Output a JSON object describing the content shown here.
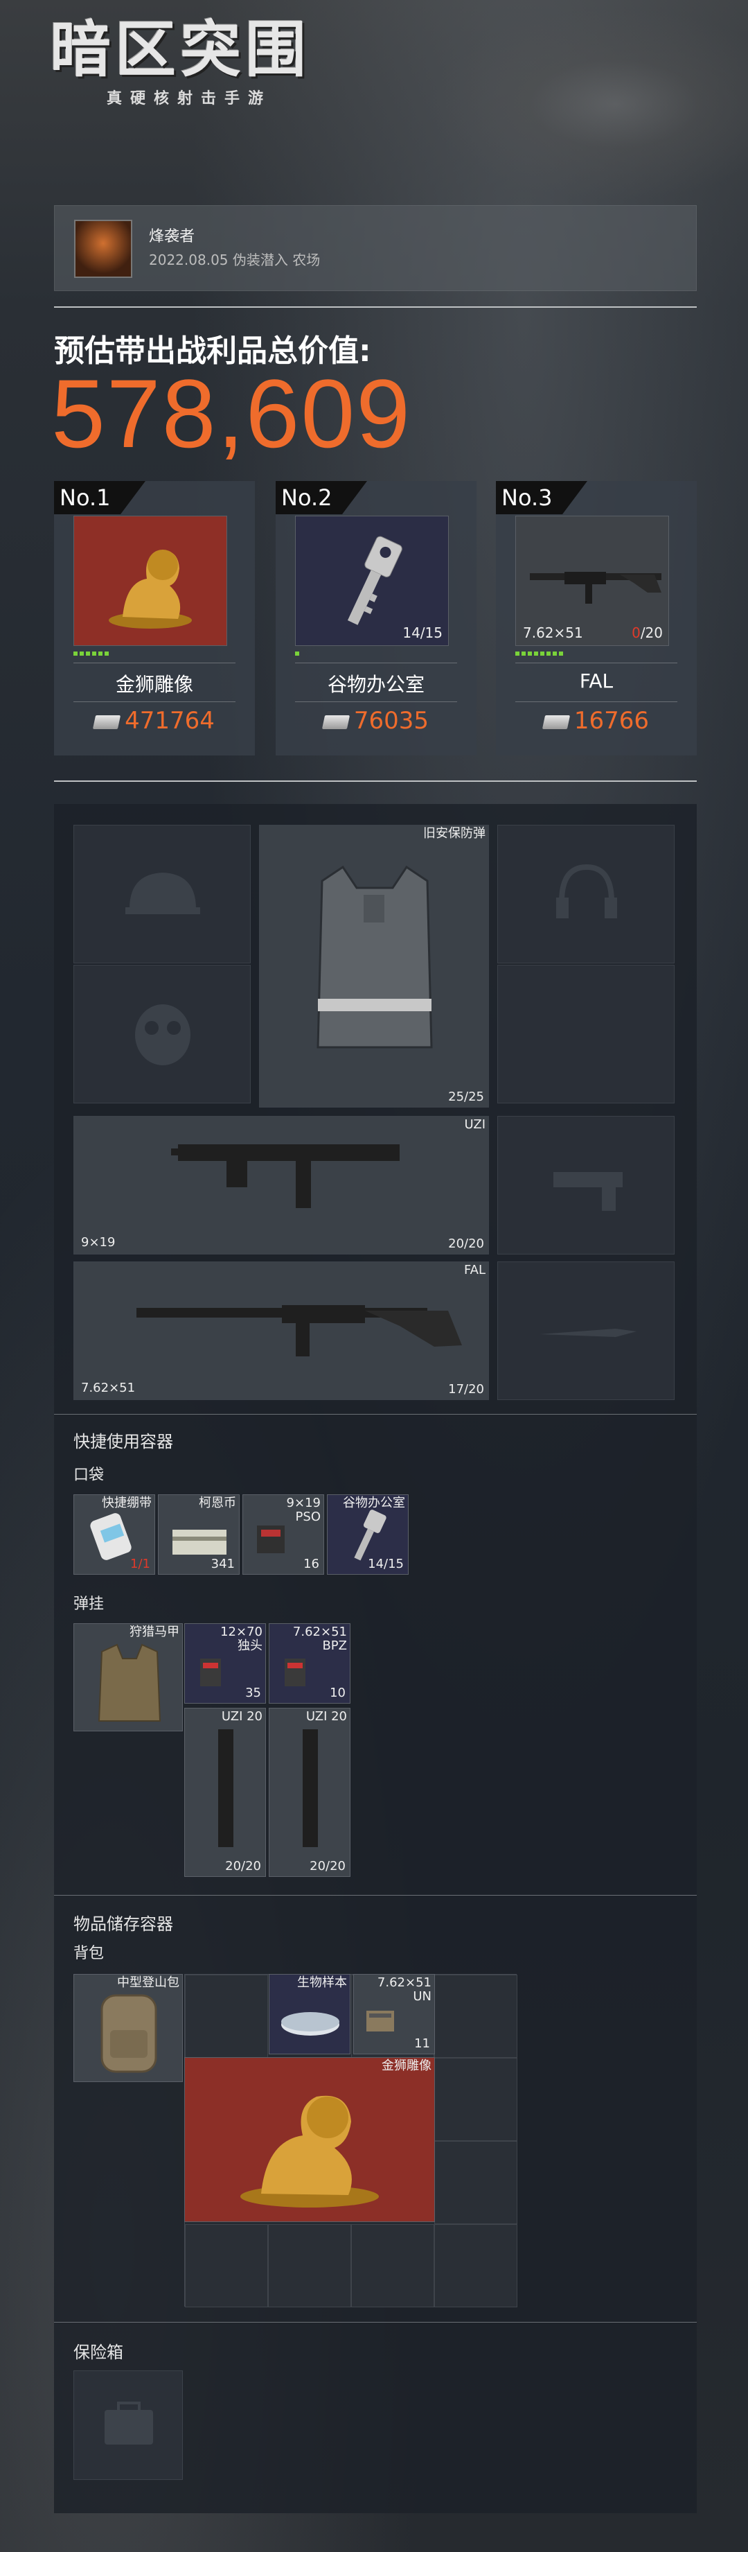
{
  "logo": {
    "title": "暗区突围",
    "subtitle": "真硬核射击手游"
  },
  "user": {
    "name": "烽袭者",
    "info": "2022.08.05 伪装潜入 农场"
  },
  "summary": {
    "label": "预估带出战利品总价值:",
    "value": "578,609"
  },
  "top_items": [
    {
      "rank": "No.1",
      "name": "金狮雕像",
      "price": "471764",
      "count": "",
      "caliber": "",
      "bg": "#8e2f26",
      "rarity": 6
    },
    {
      "rank": "No.2",
      "name": "谷物办公室",
      "price": "76035",
      "count": "14/15",
      "caliber": "",
      "bg": "#2b2d45",
      "rarity": 1
    },
    {
      "rank": "No.3",
      "name": "FAL",
      "price": "16766",
      "count_red": "0",
      "count": "/20",
      "caliber": "7.62×51",
      "bg": "#3f4348",
      "rarity": 8
    }
  ],
  "equipment": {
    "armor": {
      "label": "旧安保防弹",
      "count": "25/25"
    },
    "primary": {
      "label": "UZI",
      "caliber": "9×19",
      "count": "20/20"
    },
    "secondary": {
      "label": "FAL",
      "caliber": "7.62×51",
      "count": "17/20"
    }
  },
  "quick": {
    "title": "快捷使用容器",
    "pocket_title": "口袋",
    "pocket": [
      {
        "label": "快捷绷带",
        "count": "1/1",
        "bg": "#3e444b"
      },
      {
        "label": "柯恩币",
        "count": "341",
        "bg": "#3e444b"
      },
      {
        "label": "9×19\nPSO",
        "count": "16",
        "bg": "#3e444b"
      },
      {
        "label": "谷物办公室",
        "count": "14/15",
        "bg": "#2c2e48"
      }
    ],
    "rig_title": "弹挂",
    "rig": {
      "label": "狩猎马甲"
    },
    "rig_items": [
      {
        "label": "12×70\n独头",
        "count": "35"
      },
      {
        "label": "7.62×51\nBPZ",
        "count": "10"
      },
      {
        "label": "UZI 20",
        "count": "20/20"
      },
      {
        "label": "UZI 20",
        "count": "20/20"
      }
    ]
  },
  "storage": {
    "title": "物品储存容器",
    "backpack_title": "背包",
    "backpack": {
      "label": "中型登山包"
    },
    "items": [
      {
        "label": "生物样本",
        "count": ""
      },
      {
        "label": "7.62×51\nUN",
        "count": "11"
      },
      {
        "label": "金狮雕像",
        "count": ""
      }
    ],
    "safe_title": "保险箱"
  },
  "colors": {
    "accent": "#ef6c2c",
    "rarity_green": "#7ad33a"
  }
}
